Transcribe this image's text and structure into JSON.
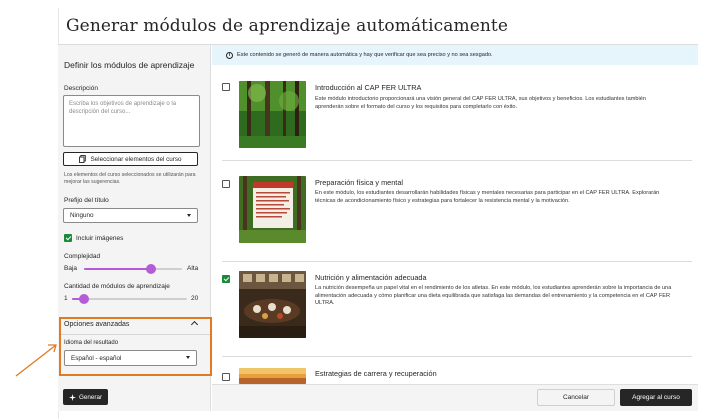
{
  "dialog": {
    "title": "Generar módulos de aprendizaje automáticamente"
  },
  "left_panel": {
    "heading": "Definir los módulos de aprendizaje",
    "description_label": "Descripción",
    "description_placeholder": "Escriba los objetivos de aprendizaje o la descripción del curso...",
    "select_items_button": "Seleccionar elementos del curso",
    "select_items_hint": "Los elementos del curso seleccionados se utilizarán para mejorar las sugerencias.",
    "title_prefix_label": "Prefijo del título",
    "title_prefix_value": "Ninguno",
    "include_images_label": "Incluir imágenes",
    "include_images_checked": true,
    "complexity_label": "Complejidad",
    "complexity_min": "Baja",
    "complexity_max": "Alta",
    "complexity_level": 0.68,
    "module_count_label": "Cantidad de módulos de aprendizaje",
    "module_count_min": "1",
    "module_count_max": "20",
    "module_count_value": 3,
    "advanced_options_label": "Opciones avanzadas",
    "result_language_label": "Idioma del resultado",
    "result_language_value": "Español - español",
    "generate_button": "Generar"
  },
  "banner": {
    "text": "Este contenido se generó de manera automática y hay que verificar que sea preciso y no sea sesgado."
  },
  "modules": [
    {
      "title": "Introducción al CAP FER ULTRA",
      "description": "Este módulo introductorio proporcionará una visión general del CAP FER ULTRA, sus objetivos y beneficios. Los estudiantes también aprenderán sobre el formato del curso y los requisitos para completarlo con éxito.",
      "checked": false,
      "image": "forest-image"
    },
    {
      "title": "Preparación física y mental",
      "description": "En este módulo, los estudiantes desarrollarán habilidades físicas y mentales necesarias para participar en el CAP FER ULTRA. Explorarán técnicas de acondicionamiento físico y estrategias para fortalecer la resistencia mental y la motivación.",
      "checked": false,
      "image": "trees-document-image"
    },
    {
      "title": "Nutrición y alimentación adecuada",
      "description": "La nutrición desempeña un papel vital en el rendimiento de los atletas. En este módulo, los estudiantes aprenderán sobre la importancia de una alimentación adecuada y cómo planificar una dieta equilibrada que satisfaga las demandas del entrenamiento y la competencia en el CAP FER ULTRA.",
      "checked": true,
      "image": "dining-table-image"
    },
    {
      "title": "Estrategias de carrera y recuperación",
      "description": "",
      "checked": false,
      "image": "sunset-image"
    }
  ],
  "footer": {
    "cancel_button": "Cancelar",
    "add_button": "Agregar al curso"
  },
  "colors": {
    "accent_purple": "#b45cd8",
    "check_green": "#1a8a3a",
    "highlight_orange": "#e07a23",
    "banner_blue": "#e6f4fb",
    "dark_button": "#262626"
  }
}
